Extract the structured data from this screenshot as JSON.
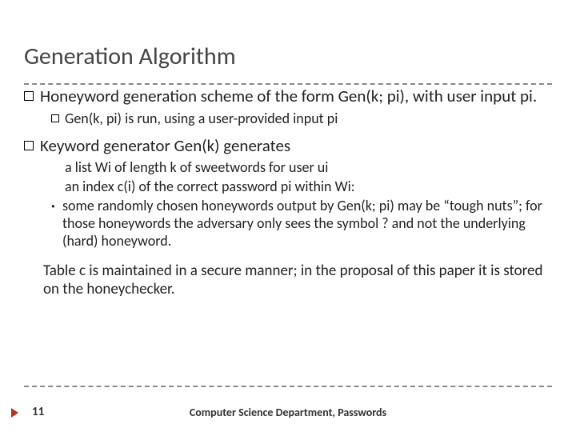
{
  "title": "Generation Algorithm",
  "bullets": {
    "b1": "Honeyword generation scheme of the form Gen(k; pi), with user input pi.",
    "b1a": "Gen(k, pi) is run, using a user-provided input pi",
    "b2": "Keyword generator Gen(k) generates",
    "b2a": "a list Wi of length k of sweetwords for user ui",
    "b2b": "an index c(i) of the correct password pi within Wi:",
    "b2c": "some randomly chosen honeywords output by Gen(k; pi) may be “tough nuts”; for those honeywords the adversary only sees the symbol ? and not the underlying (hard) honeyword."
  },
  "para": "Table c is maintained in a secure manner; in the proposal of this paper it is stored on the honeychecker.",
  "footer": {
    "page": "11",
    "center": "Computer Science Department, Passwords"
  }
}
